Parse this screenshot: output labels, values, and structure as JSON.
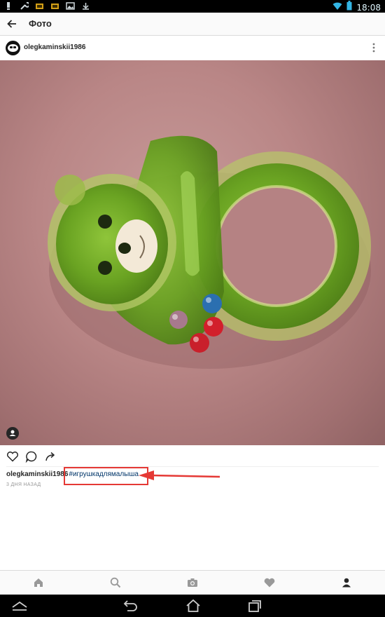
{
  "status_bar": {
    "time": "18:08",
    "left_icons": [
      "notification-icon",
      "wrench-icon",
      "game-icon",
      "game-icon",
      "image-icon",
      "download-icon"
    ],
    "right_icons": [
      "wifi-icon",
      "battery-icon"
    ]
  },
  "top_bar": {
    "title": "Фото"
  },
  "post": {
    "username": "olegkaminskii1986",
    "caption_user": "olegkaminskii1986",
    "hashtag": "#игрушкадлямалыша",
    "time_ago": "3 ДНЯ НАЗАД",
    "accent_link_color": "#003569",
    "annotation_color": "#e53935"
  },
  "bottom_nav": {
    "items": [
      "home-icon",
      "search-icon",
      "camera-icon",
      "heart-icon",
      "profile-icon"
    ],
    "active": "profile-icon"
  },
  "system_nav": {
    "items": [
      "hide-icon",
      "back-icon",
      "home-icon",
      "recents-icon"
    ]
  }
}
